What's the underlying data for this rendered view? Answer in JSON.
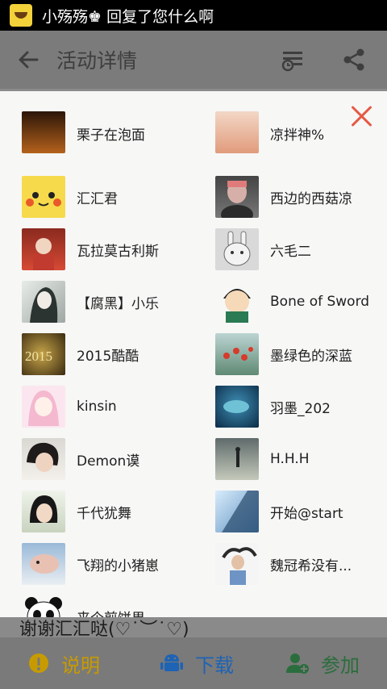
{
  "notification": {
    "text": "小殇殇♚ 回复了您什么啊"
  },
  "appbar": {
    "title": "活动详情"
  },
  "modal": {
    "partial_top_left": "栗子在泡面",
    "partial_top_right": "凉拌神%",
    "members": [
      "汇汇君",
      "西边的西菇凉",
      "瓦拉莫古利斯",
      "六毛二",
      "【腐黑】小乐",
      "Bone of Sword",
      "2015酷酷",
      "墨绿色的深蓝",
      "kinsin",
      "羽墨_202",
      "Demon谟",
      "H.H.H",
      "千代犹舞",
      "开始@start",
      "飞翔的小猪崽",
      "魏冠希没有..."
    ],
    "partial_bottom_left": "来个煎饼果"
  },
  "behind": {
    "comment": "谢谢汇汇哒(♡˙︶˙♡)"
  },
  "bottombar": {
    "explain": "说明",
    "download": "下载",
    "join": "参加"
  },
  "colors": {
    "accent_red": "#e55a44",
    "yellow": "#c79b00",
    "blue": "#1e63b4",
    "green": "#2b6d3d"
  }
}
